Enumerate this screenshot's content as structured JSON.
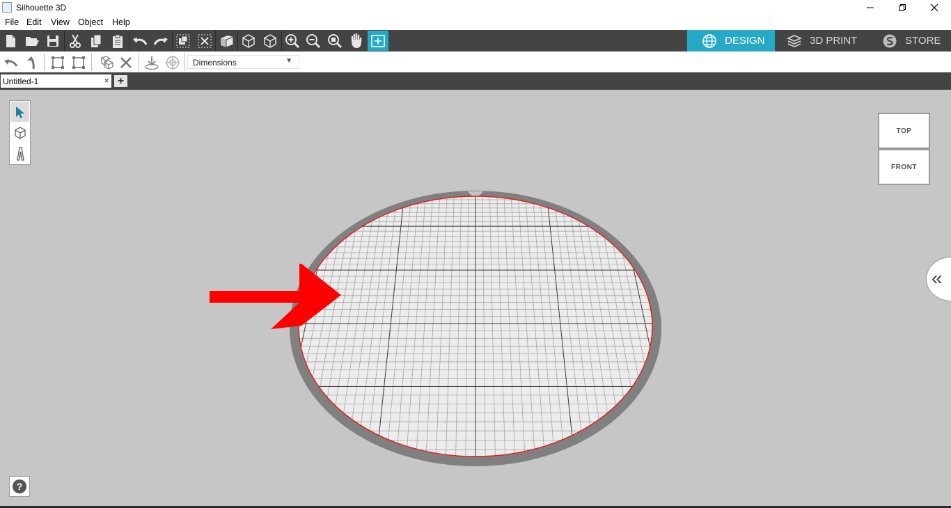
{
  "window": {
    "title": "Silhouette 3D"
  },
  "menu": [
    "File",
    "Edit",
    "View",
    "Object",
    "Help"
  ],
  "toolbar": {
    "tools": [
      "new-file-icon",
      "open-folder-icon",
      "save-icon",
      "cut-icon",
      "copy-icon",
      "paste-icon",
      "undo-icon",
      "redo-icon",
      "group-icon",
      "ungroup-icon",
      "extrude-icon",
      "cube-outline-icon",
      "cube-solid-icon",
      "zoom-in-icon",
      "zoom-out-icon",
      "zoom-fit-icon",
      "pan-hand-icon",
      "fit-to-view-icon"
    ],
    "modes": [
      {
        "label": "DESIGN",
        "icon": "globe-icon",
        "active": true
      },
      {
        "label": "3D PRINT",
        "icon": "print-layers-icon",
        "active": false
      },
      {
        "label": "STORE",
        "icon": "store-s-icon",
        "active": false
      }
    ],
    "accent_color": "#25a9c6"
  },
  "toolbar2": {
    "tools": [
      "rotate-left-icon",
      "rotate-up-icon",
      "align-icon",
      "resize-icon",
      "boolean-icon",
      "delete-icon",
      "drop-to-floor-icon",
      "center-icon"
    ],
    "dimensions_select": {
      "value": "Dimensions"
    }
  },
  "tabs": {
    "items": [
      {
        "name": "Untitled-1"
      }
    ],
    "close_symbol": "×",
    "add_symbol": "+"
  },
  "palette": {
    "tools": [
      "select-arrow-icon",
      "cube-icon",
      "text-a-icon"
    ]
  },
  "view_cube": {
    "top_label": "TOP",
    "front_label": "FRONT"
  },
  "panel_toggle": {
    "symbol": "«"
  },
  "help": {
    "symbol": "?"
  },
  "annotation": {
    "color": "#ff0000"
  }
}
